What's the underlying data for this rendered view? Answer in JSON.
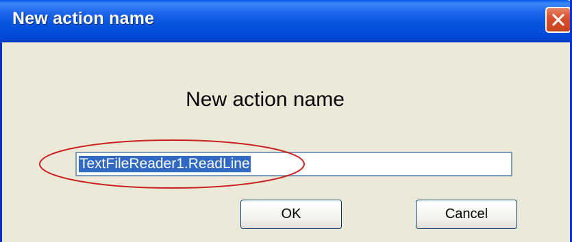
{
  "window": {
    "title": "New action name",
    "close_icon": "close-icon",
    "accent_color": "#0453dd",
    "close_color": "#d9512c"
  },
  "dialog": {
    "heading": "New action name",
    "input": {
      "value": "TextFileReader1.ReadLine",
      "selected": true,
      "annotation": "red-ellipse"
    },
    "buttons": {
      "ok_label": "OK",
      "cancel_label": "Cancel"
    }
  }
}
